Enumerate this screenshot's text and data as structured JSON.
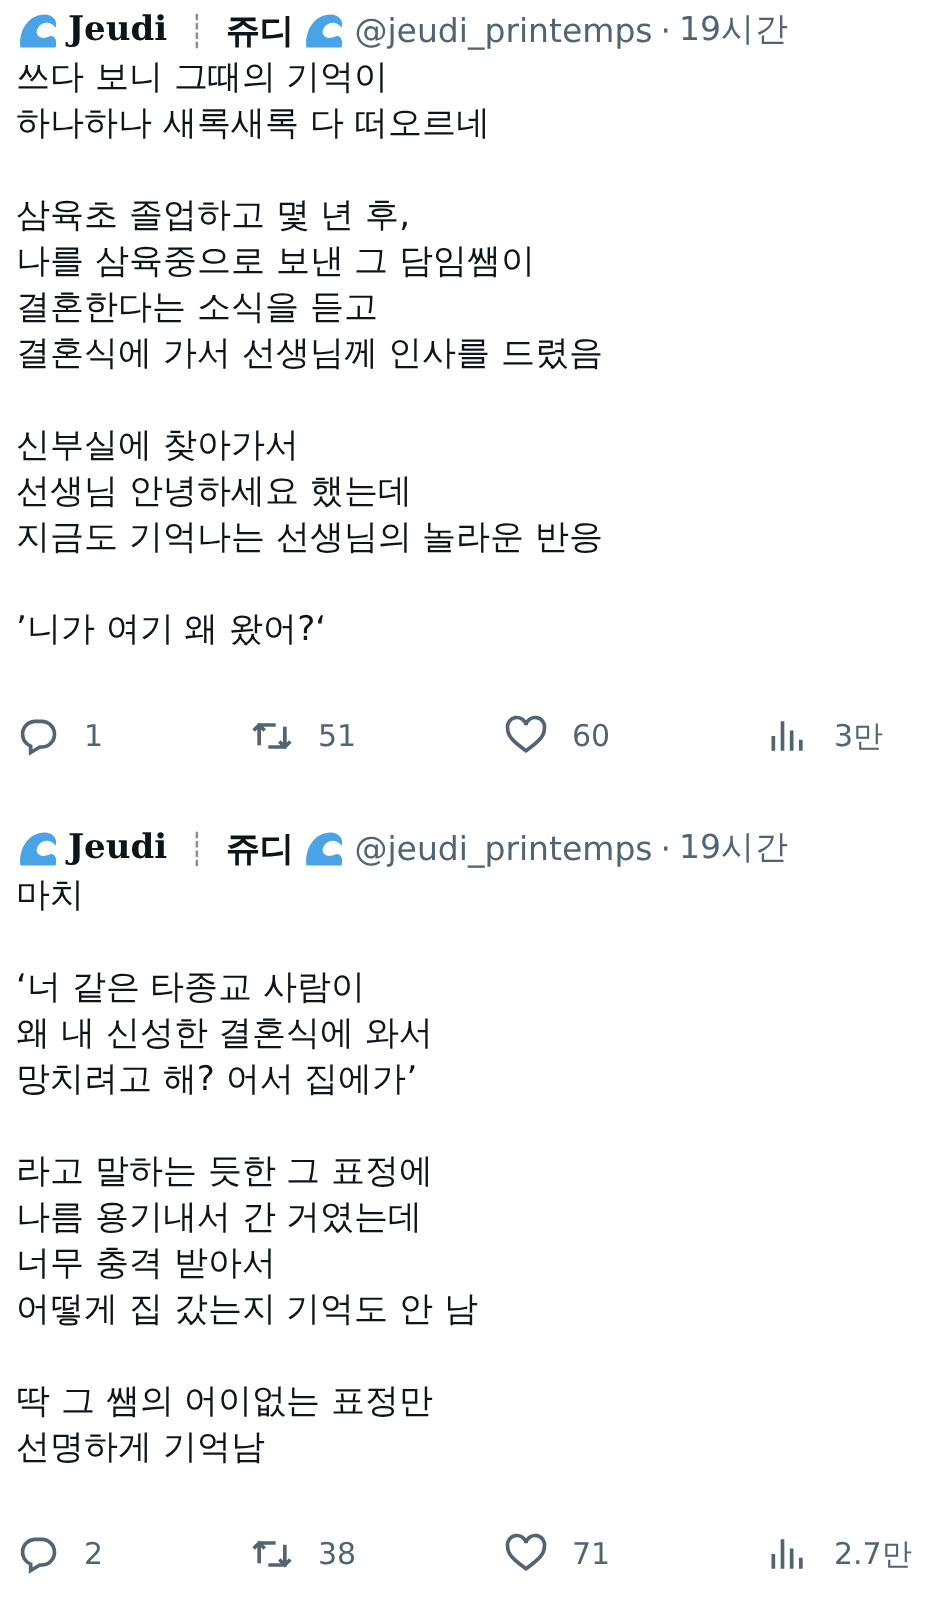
{
  "tweets": [
    {
      "author": {
        "name_latin": "Jeudi",
        "separator": "┊",
        "name_korean": "쥬디",
        "handle": "@jeudi_printemps",
        "dot": "·",
        "time": "19시간"
      },
      "paragraphs": [
        "쓰다 보니 그때의 기억이\n하나하나 새록새록 다 떠오르네",
        "삼육초 졸업하고 몇 년 후,\n나를 삼육중으로 보낸 그 담임쌤이\n결혼한다는 소식을 듣고\n결혼식에 가서 선생님께 인사를 드렸음",
        "신부실에 찾아가서\n선생님 안녕하세요 했는데\n지금도 기억나는 선생님의 놀라운 반응",
        "’니가 여기 왜 왔어?‘"
      ],
      "actions": {
        "replies": "1",
        "reposts": "51",
        "likes": "60",
        "views": "3만"
      }
    },
    {
      "author": {
        "name_latin": "Jeudi",
        "separator": "┊",
        "name_korean": "쥬디",
        "handle": "@jeudi_printemps",
        "dot": "·",
        "time": "19시간"
      },
      "paragraphs": [
        "마치",
        "‘너 같은 타종교 사람이\n왜 내 신성한 결혼식에 와서\n망치려고 해? 어서 집에가’",
        "라고 말하는 듯한 그 표정에\n나름 용기내서 간 거였는데\n너무 충격 받아서\n어떻게 집 갔는지 기억도 안 남",
        "딱 그 쌤의 어이없는 표정만\n선명하게 기억남"
      ],
      "actions": {
        "replies": "2",
        "reposts": "38",
        "likes": "71",
        "views": "2.7만"
      }
    }
  ]
}
